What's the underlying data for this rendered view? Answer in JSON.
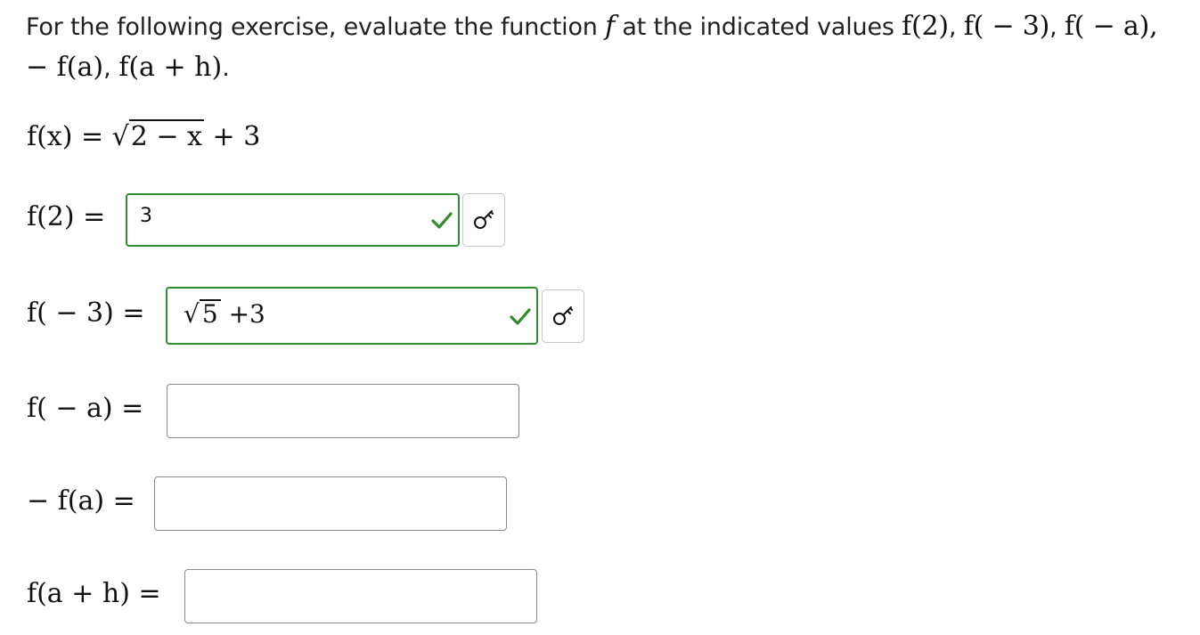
{
  "prompt": {
    "text_before": "For the following exercise, evaluate the function ",
    "func_letter": "f",
    "text_middle": " at the indicated values ",
    "value1": "f(2)",
    "sep1": ", ",
    "value2": "f( − 3)",
    "sep2": ", ",
    "value3": "f( − a),",
    "line2_value4": "− f(a)",
    "sep3": ", ",
    "line2_value5": "f(a + h)",
    "end": "."
  },
  "function_def": {
    "lhs": "f(x) = ",
    "sqrt_content": "2 − x",
    "rest": " + 3"
  },
  "rows": [
    {
      "label": "f(2) =",
      "value": "3",
      "status": "correct"
    },
    {
      "label": "f( − 3) =",
      "value_sqrt": "5",
      "value_rest": " +3",
      "status": "correct"
    },
    {
      "label": "f( − a) =",
      "value": "",
      "status": "empty"
    },
    {
      "label": "− f(a) =",
      "value": "",
      "status": "empty"
    },
    {
      "label": "f(a + h) =",
      "value": "",
      "status": "empty"
    }
  ],
  "colors": {
    "correct": "#2e8b2e",
    "border": "#8a8a8a"
  },
  "icons": {
    "check": "check-icon",
    "key": "key-icon"
  }
}
